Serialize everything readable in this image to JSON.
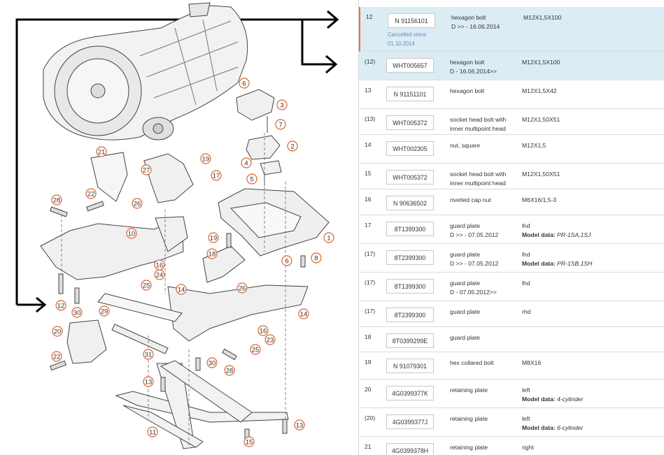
{
  "diagram": {
    "callouts": [
      "6",
      "3",
      "7",
      "2",
      "4",
      "5",
      "1",
      "6",
      "8",
      "21",
      "19",
      "27",
      "17",
      "22",
      "26",
      "28",
      "10",
      "19",
      "18",
      "16",
      "24",
      "25",
      "14",
      "26",
      "12",
      "30",
      "29",
      "14",
      "20",
      "16",
      "23",
      "25",
      "22",
      "31",
      "30",
      "28",
      "13",
      "11",
      "13",
      "15"
    ]
  },
  "parts": [
    {
      "pos": "12",
      "part_no": "N 91156101",
      "desc": [
        "hexagon bolt",
        "D >> - 16.06.2014"
      ],
      "notes": [
        "M12X1,5X100"
      ],
      "cancelled": [
        "Cancelled since",
        "01.10.2014"
      ]
    },
    {
      "pos": "(12)",
      "part_no": "WHT005657",
      "desc": [
        "hexagon bolt",
        "D - 16.06.2014>>"
      ],
      "notes": [
        "M12X1,5X100"
      ]
    },
    {
      "pos": "13",
      "part_no": "N 91151101",
      "desc": [
        "hexagon bolt"
      ],
      "notes": [
        "M12X1,5X42"
      ]
    },
    {
      "pos": "(13)",
      "part_no": "WHT005372",
      "desc": [
        "socket head bolt with",
        "inner multipoint head"
      ],
      "notes": [
        "M12X1,50X51"
      ]
    },
    {
      "pos": "14",
      "part_no": "WHT002305",
      "desc": [
        "nut, square"
      ],
      "notes": [
        "M12X1,5"
      ]
    },
    {
      "pos": "15",
      "part_no": "WHT005372",
      "desc": [
        "socket head bolt with",
        "inner multipoint head"
      ],
      "notes": [
        "M12X1,50X51"
      ]
    },
    {
      "pos": "16",
      "part_no": "N 90636502",
      "desc": [
        "rivetted cap nut"
      ],
      "notes": [
        "M6X16/1,5-3"
      ]
    },
    {
      "pos": "17",
      "part_no": "8T1399300",
      "desc": [
        "guard plate",
        "D >> - 07.05.2012"
      ],
      "notes": [
        "lhd"
      ],
      "model_label": "Model data:",
      "model_value": "PR-1SA,1SJ"
    },
    {
      "pos": "(17)",
      "part_no": "8T2399300",
      "desc": [
        "guard plate",
        "D >> - 07.05.2012"
      ],
      "notes": [
        "lhd"
      ],
      "model_label": "Model data:",
      "model_value": "PR-1SB,1SH"
    },
    {
      "pos": "(17)",
      "part_no": "8T1399300",
      "desc": [
        "guard plate",
        "D - 07.05.2012>>"
      ],
      "notes": [
        "lhd"
      ]
    },
    {
      "pos": "(17)",
      "part_no": "8T2399300",
      "desc": [
        "guard plate"
      ],
      "notes": [
        "rhd"
      ]
    },
    {
      "pos": "18",
      "part_no": "8T0399299E",
      "desc": [
        "guard plate"
      ],
      "notes": []
    },
    {
      "pos": "19",
      "part_no": "N 91079301",
      "desc": [
        "hex collared bolt"
      ],
      "notes": [
        "M8X16"
      ]
    },
    {
      "pos": "20",
      "part_no": "4G0399377K",
      "desc": [
        "retaining plate"
      ],
      "notes": [
        "left"
      ],
      "model_label": "Model data:",
      "model_value": "4-cylinder"
    },
    {
      "pos": "(20)",
      "part_no": "4G0399377J",
      "desc": [
        "retaining plate"
      ],
      "notes": [
        "left"
      ],
      "model_label": "Model data:",
      "model_value": "6-cylinder"
    },
    {
      "pos": "21",
      "part_no": "4G0399378H",
      "desc": [
        "retaining plate"
      ],
      "notes": [
        "right"
      ]
    }
  ],
  "colors": {
    "highlight": "#dcecf4",
    "accent": "#e1732d",
    "callout": "#e0642e",
    "cancelled": "#5a8fc4"
  }
}
